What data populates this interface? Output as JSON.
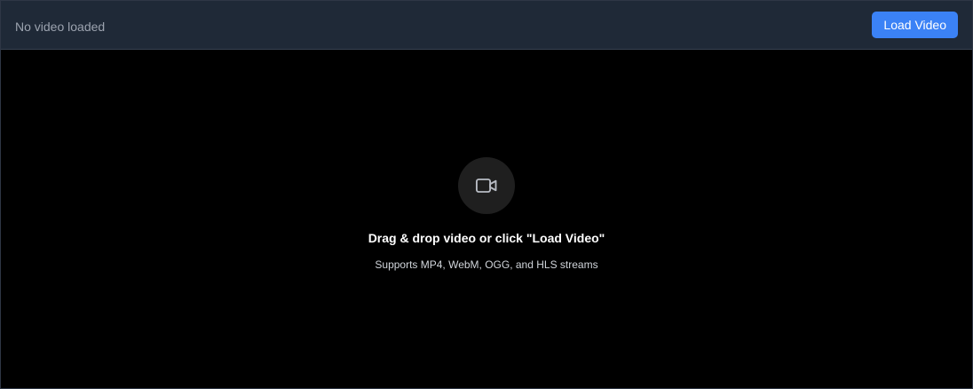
{
  "header": {
    "status": "No video loaded",
    "load_button_label": "Load Video"
  },
  "drop_zone": {
    "icon": "video-camera-icon",
    "title": "Drag & drop video or click \"Load Video\"",
    "subtitle": "Supports MP4, WebM, OGG, and HLS streams"
  },
  "colors": {
    "header_bg": "#1f2937",
    "accent": "#3b82f6",
    "background": "#000000"
  }
}
